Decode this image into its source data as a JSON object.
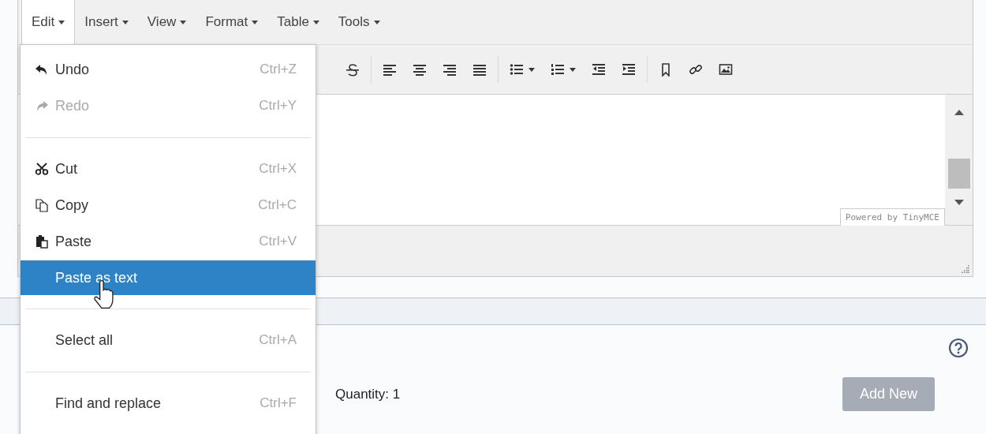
{
  "menubar": [
    {
      "label": "Edit",
      "selected": true
    },
    {
      "label": "Insert",
      "selected": false
    },
    {
      "label": "View",
      "selected": false
    },
    {
      "label": "Format",
      "selected": false
    },
    {
      "label": "Table",
      "selected": false
    },
    {
      "label": "Tools",
      "selected": false
    }
  ],
  "edit_menu": {
    "groups": [
      [
        {
          "label": "Undo",
          "shortcut": "Ctrl+Z",
          "disabled": false,
          "selected": false,
          "kind": "undo"
        },
        {
          "label": "Redo",
          "shortcut": "Ctrl+Y",
          "disabled": true,
          "selected": false,
          "kind": "redo"
        }
      ],
      [
        {
          "label": "Cut",
          "shortcut": "Ctrl+X",
          "disabled": false,
          "selected": false,
          "kind": "cut"
        },
        {
          "label": "Copy",
          "shortcut": "Ctrl+C",
          "disabled": false,
          "selected": false,
          "kind": "copy"
        },
        {
          "label": "Paste",
          "shortcut": "Ctrl+V",
          "disabled": false,
          "selected": false,
          "kind": "paste"
        },
        {
          "label": "Paste as text",
          "disabled": false,
          "selected": true,
          "kind": "plain"
        }
      ],
      [
        {
          "label": "Select all",
          "shortcut": "Ctrl+A",
          "disabled": false,
          "selected": false,
          "kind": "plain"
        }
      ],
      [
        {
          "label": "Find and replace",
          "shortcut": "Ctrl+F",
          "disabled": false,
          "selected": false,
          "kind": "plain"
        }
      ]
    ]
  },
  "editor": {
    "powered_by": "Powered by TinyMCE"
  },
  "section": {
    "quantity": "Quantity: 1",
    "add_button": {
      "label": "Add New",
      "disabled": true
    }
  }
}
